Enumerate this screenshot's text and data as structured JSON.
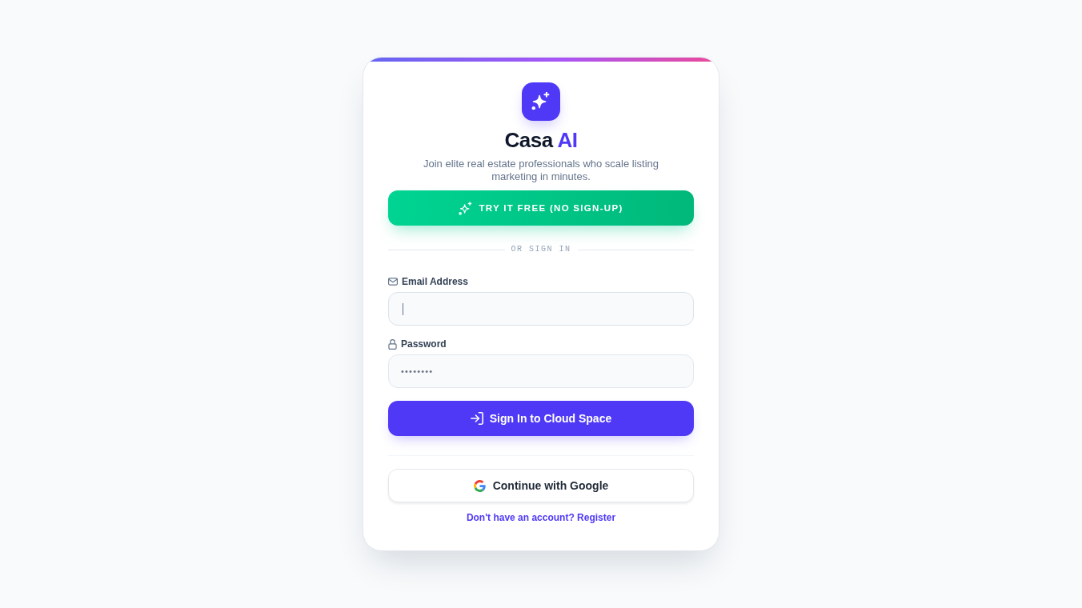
{
  "brand": {
    "name": "Casa",
    "name_accent": "AI",
    "tagline": "Join elite real estate professionals who scale listing marketing in minutes."
  },
  "trial_button": {
    "label": "TRY IT FREE (NO SIGN-UP)"
  },
  "divider": {
    "label": "OR SIGN IN"
  },
  "fields": [
    {
      "kind": "email",
      "label": "Email Address",
      "focused": true
    },
    {
      "kind": "password",
      "label": "Password",
      "value": "••••••••",
      "focused": false
    }
  ],
  "sign_in_button": {
    "label": "Sign In to Cloud Space"
  },
  "google_button": {
    "label": "Continue with Google"
  },
  "register_link": {
    "label": "Don't have an account? Register"
  }
}
